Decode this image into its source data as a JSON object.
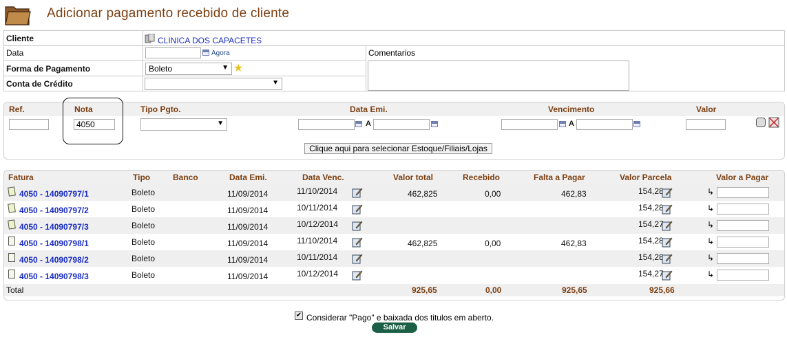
{
  "header": {
    "title": "Adicionar pagamento recebido de cliente"
  },
  "form": {
    "cliente_label": "Cliente",
    "cliente_value": "CLINICA DOS CAPACETES",
    "data_label": "Data",
    "data_value": "",
    "agora_link": "Agora",
    "comentarios_label": "Comentarios",
    "forma_label": "Forma de Pagamento",
    "forma_value": "Boleto",
    "conta_label": "Conta de Crédito",
    "conta_value": ""
  },
  "filter": {
    "headers": {
      "ref": "Ref.",
      "nota": "Nota",
      "tipo": "Tipo Pgto.",
      "data_emi": "Data Emi.",
      "vencimento": "Vencimento",
      "valor": "Valor"
    },
    "ref_value": "",
    "nota_value": "4050",
    "tipo_value": "",
    "between_label": "A",
    "select_button": "Clique aqui para selecionar Estoque/Filiais/Lojas"
  },
  "table": {
    "headers": {
      "fatura": "Fatura",
      "tipo": "Tipo",
      "banco": "Banco",
      "data_emi": "Data Emi.",
      "data_venc": "Data Venc.",
      "valor_total": "Valor total",
      "recebido": "Recebido",
      "falta": "Falta a Pagar",
      "parcela": "Valor Parcela",
      "valor_pagar": "Valor a Pagar"
    },
    "rows": [
      {
        "fatura": "4050 - 14090797/1",
        "tipo": "Boleto",
        "banco": "",
        "data_emi": "11/09/2014",
        "data_venc": "11/10/2014",
        "valor_total": "462,825",
        "recebido": "0,00",
        "falta": "462,83",
        "parcela": "154,28"
      },
      {
        "fatura": "4050 - 14090797/2",
        "tipo": "Boleto",
        "banco": "",
        "data_emi": "11/09/2014",
        "data_venc": "10/11/2014",
        "valor_total": "",
        "recebido": "",
        "falta": "",
        "parcela": "154,28"
      },
      {
        "fatura": "4050 - 14090797/3",
        "tipo": "Boleto",
        "banco": "",
        "data_emi": "11/09/2014",
        "data_venc": "10/12/2014",
        "valor_total": "",
        "recebido": "",
        "falta": "",
        "parcela": "154,27"
      },
      {
        "fatura": "4050 - 14090798/1",
        "tipo": "Boleto",
        "banco": "",
        "data_emi": "11/09/2014",
        "data_venc": "11/10/2014",
        "valor_total": "462,825",
        "recebido": "0,00",
        "falta": "462,83",
        "parcela": "154,28"
      },
      {
        "fatura": "4050 - 14090798/2",
        "tipo": "Boleto",
        "banco": "",
        "data_emi": "11/09/2014",
        "data_venc": "10/11/2014",
        "valor_total": "",
        "recebido": "",
        "falta": "",
        "parcela": "154,28"
      },
      {
        "fatura": "4050 - 14090798/3",
        "tipo": "Boleto",
        "banco": "",
        "data_emi": "11/09/2014",
        "data_venc": "10/12/2014",
        "valor_total": "",
        "recebido": "",
        "falta": "",
        "parcela": "154,27"
      }
    ],
    "total": {
      "label": "Total",
      "valor_total": "925,65",
      "recebido": "0,00",
      "falta": "925,65",
      "parcela": "925,66"
    }
  },
  "footer": {
    "checkbox_label": "Considerar \"Pago\" e baixada dos titulos em aberto.",
    "checkbox_checked": true,
    "save_button": "Salvar"
  },
  "colors": {
    "title": "#7a3e10",
    "link": "#1a2ec4",
    "save_button": "#1c5f47"
  }
}
